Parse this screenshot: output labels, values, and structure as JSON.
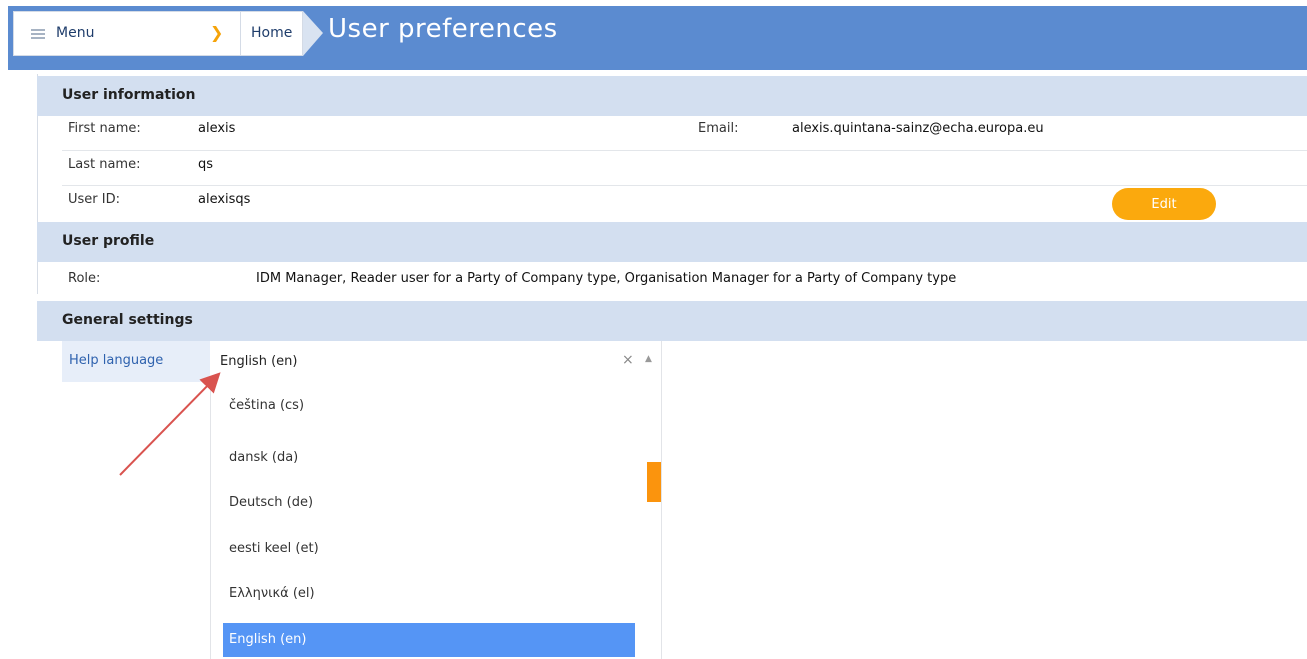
{
  "topbar": {
    "menu_label": "Menu",
    "home_label": "Home",
    "page_title": "User preferences"
  },
  "user_information": {
    "title": "User information",
    "first_name_label": "First name:",
    "first_name_value": "alexis",
    "email_label": "Email:",
    "email_value": "alexis.quintana-sainz@echa.europa.eu",
    "last_name_label": "Last name:",
    "last_name_value": "qs",
    "user_id_label": "User ID:",
    "user_id_value": "alexisqs",
    "edit_label": "Edit"
  },
  "user_profile": {
    "title": "User profile",
    "role_label": "Role:",
    "role_value": "IDM Manager, Reader user for a Party of Company type, Organisation Manager for a Party of Company type"
  },
  "general_settings": {
    "title": "General settings",
    "help_language_label": "Help language",
    "help_language_value": "English (en)",
    "clear_glyph": "×",
    "caret_glyph": "▲",
    "options": [
      "čeština (cs)",
      "dansk (da)",
      "Deutsch (de)",
      "eesti keel (et)",
      "Ελληνικά (el)",
      "English (en)"
    ],
    "selected_option": "English (en)"
  },
  "colors": {
    "topbar": "#5b8bd0",
    "section": "#d3dff0",
    "accent": "#fba90d",
    "selected": "#5595f5",
    "annotation_arrow": "#d9534f"
  },
  "icons": {
    "menu": "hamburger-icon",
    "dropdown": "chevron-down-icon",
    "clear": "close-icon",
    "caret": "caret-up-icon"
  }
}
